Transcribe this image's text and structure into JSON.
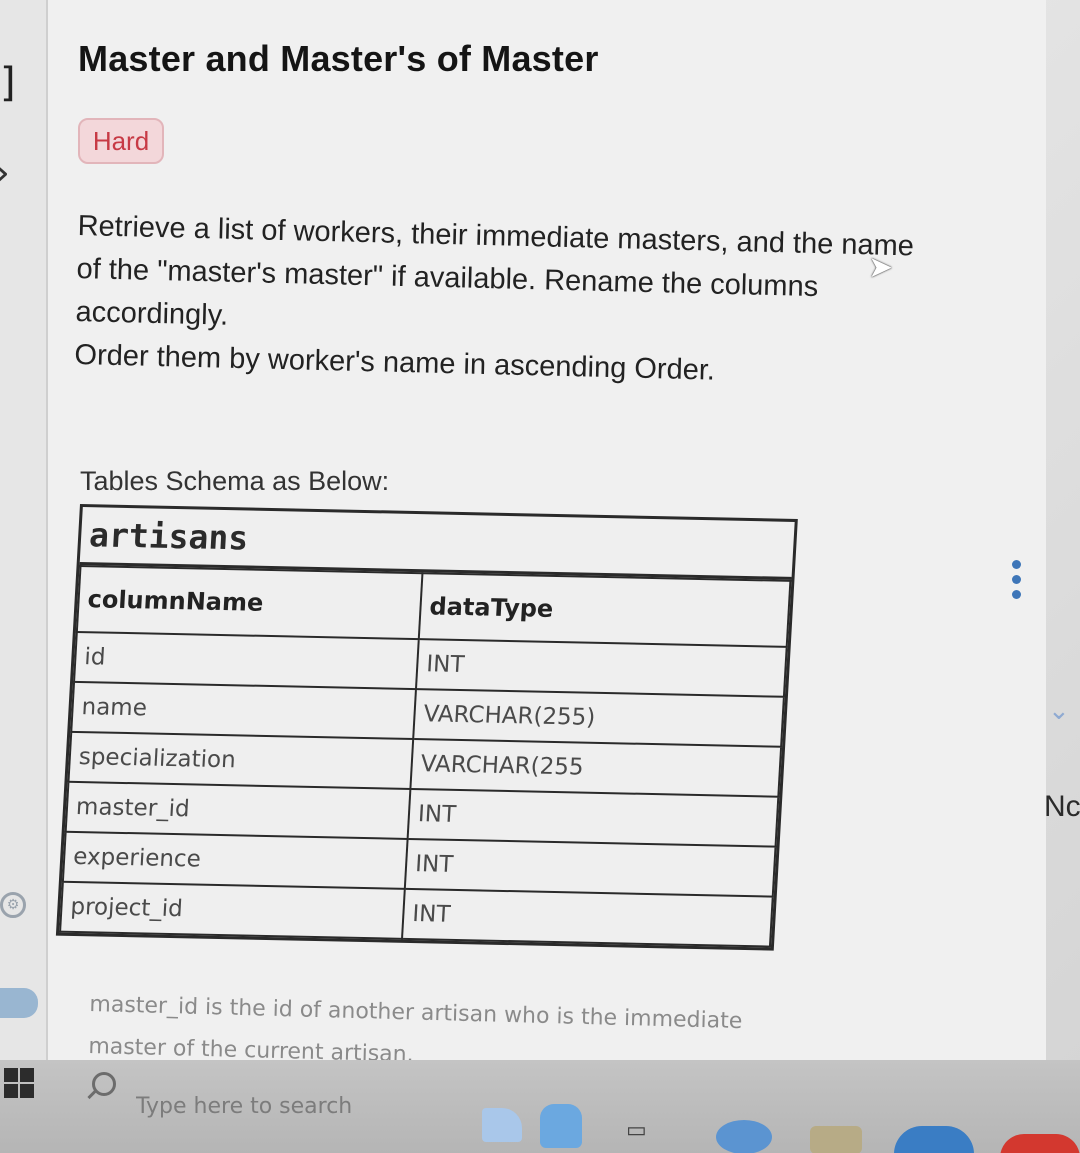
{
  "problem": {
    "title": "Master and Master's of Master",
    "difficulty": "Hard",
    "description_lines": [
      "Retrieve a list of workers, their immediate masters, and the name",
      "of the \"master's master\" if available. Rename the columns",
      "accordingly.",
      "Order them by worker's name in ascending Order."
    ],
    "schema_label": "Tables Schema as Below:",
    "table": {
      "name": "artisans",
      "headers": [
        "columnName",
        "dataType"
      ],
      "rows": [
        [
          "id",
          "INT"
        ],
        [
          "name",
          "VARCHAR(255)"
        ],
        [
          "specialization",
          "VARCHAR(255"
        ],
        [
          "master_id",
          "INT"
        ],
        [
          "experience",
          "INT"
        ],
        [
          "project_id",
          "INT"
        ]
      ]
    },
    "footnote_lines": [
      "master_id is the id of another artisan who is the immediate",
      "master of the current artisan."
    ]
  },
  "side_panel": {
    "partial_label": "Nc"
  },
  "taskbar": {
    "search_placeholder": "Type here to search"
  },
  "colors": {
    "difficulty_text": "#c73a45",
    "difficulty_bg": "#f3d7da",
    "kebab": "#3e76b8"
  },
  "icons": [
    "bracket-icon",
    "chevron-right-icon",
    "gear-icon",
    "kebab-menu-icon",
    "chevron-down-icon",
    "mouse-cursor-icon",
    "windows-start-icon",
    "search-icon",
    "taskview-icon"
  ]
}
